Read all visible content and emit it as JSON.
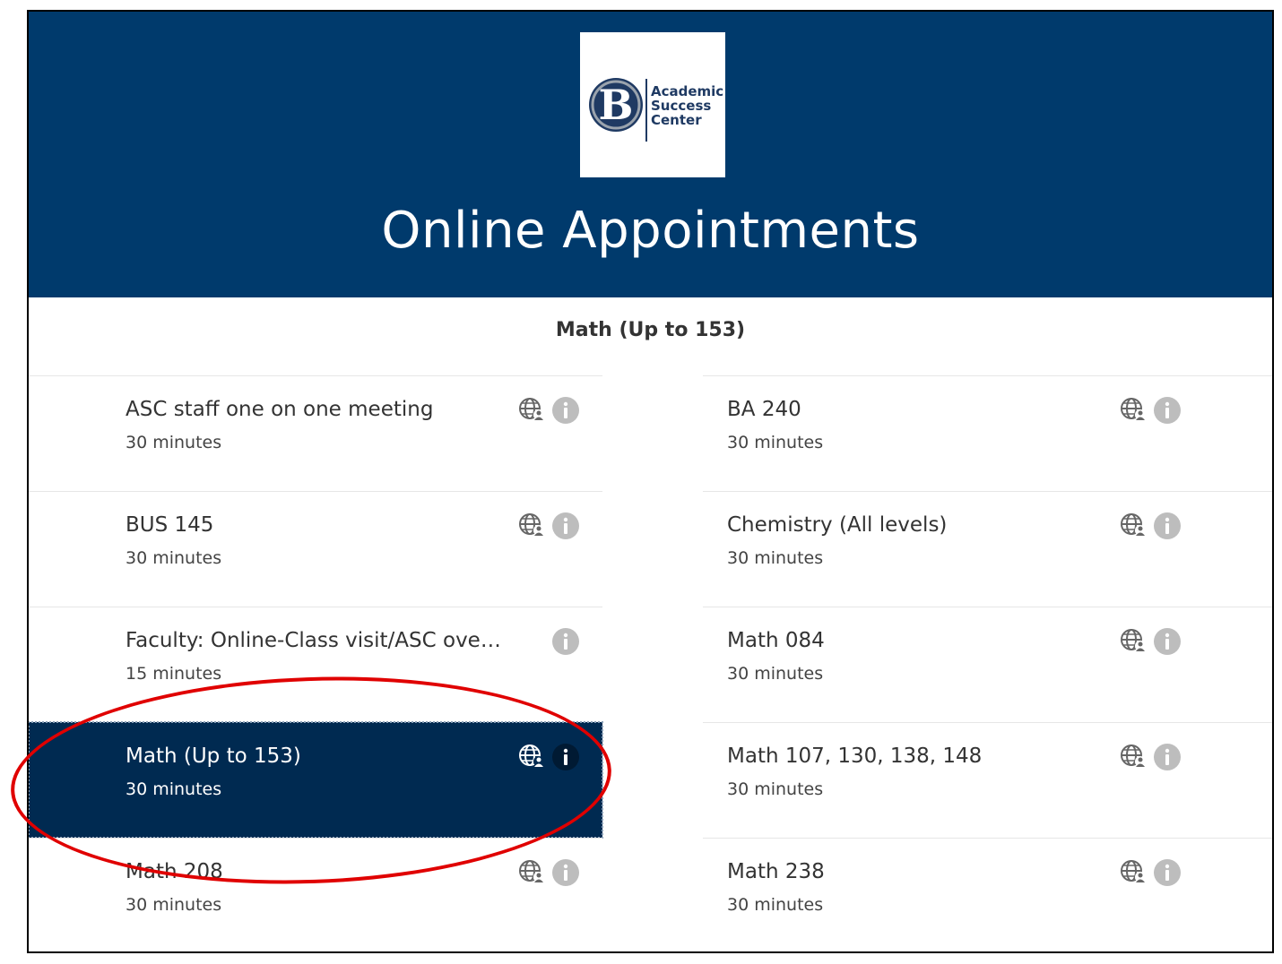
{
  "header": {
    "logo": {
      "letter": "B",
      "line1": "Academic",
      "line2": "Success",
      "line3": "Center"
    },
    "title": "Online Appointments"
  },
  "selected_service_title": "Math (Up to 153)",
  "services_left": [
    {
      "name": "ASC staff one on one meeting",
      "duration": "30 minutes",
      "online": true,
      "selected": false
    },
    {
      "name": "BUS 145",
      "duration": "30 minutes",
      "online": true,
      "selected": false
    },
    {
      "name": "Faculty: Online-Class visit/ASC overvie...",
      "duration": "15 minutes",
      "online": false,
      "selected": false
    },
    {
      "name": "Math (Up to 153)",
      "duration": "30 minutes",
      "online": true,
      "selected": true
    },
    {
      "name": "Math 208",
      "duration": "30 minutes",
      "online": true,
      "selected": false
    }
  ],
  "services_right": [
    {
      "name": "BA 240",
      "duration": "30 minutes",
      "online": true,
      "selected": false
    },
    {
      "name": "Chemistry (All levels)",
      "duration": "30 minutes",
      "online": true,
      "selected": false
    },
    {
      "name": "Math 084",
      "duration": "30 minutes",
      "online": true,
      "selected": false
    },
    {
      "name": "Math 107, 130, 138, 148",
      "duration": "30 minutes",
      "online": true,
      "selected": false
    },
    {
      "name": "Math 238",
      "duration": "30 minutes",
      "online": true,
      "selected": false
    }
  ],
  "icons": {
    "online": "globe-person-icon",
    "info": "info-icon"
  },
  "colors": {
    "header_bg": "#003A6C",
    "selected_bg": "#002A51",
    "annotation": "#e00000"
  }
}
